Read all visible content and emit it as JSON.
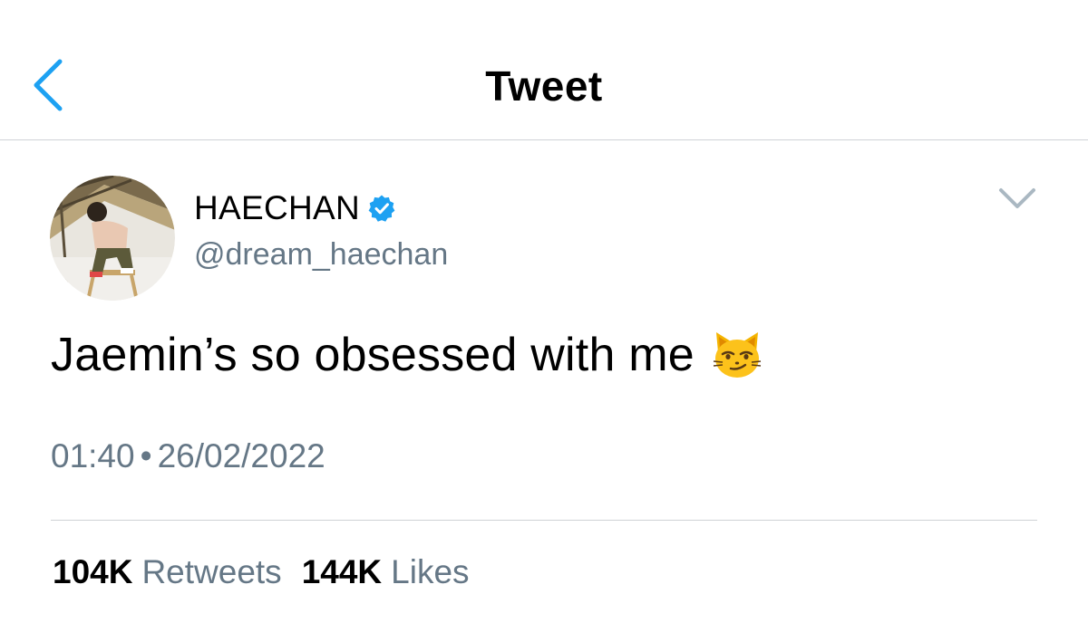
{
  "header": {
    "title": "Tweet",
    "back_icon": "chevron-left-icon",
    "accent_color": "#1da1f2"
  },
  "tweet": {
    "author": {
      "display_name": "HAECHAN",
      "handle": "@dream_haechan",
      "verified": true,
      "verified_icon": "verified-badge-icon"
    },
    "menu_icon": "chevron-down-icon",
    "text": "Jaemin’s so obsessed with me",
    "emoji": "😼",
    "time": "01:40",
    "separator": "•",
    "date": "26/02/2022",
    "stats": {
      "retweets_count": "104K",
      "retweets_label": "Retweets",
      "likes_count": "144K",
      "likes_label": "Likes"
    }
  }
}
